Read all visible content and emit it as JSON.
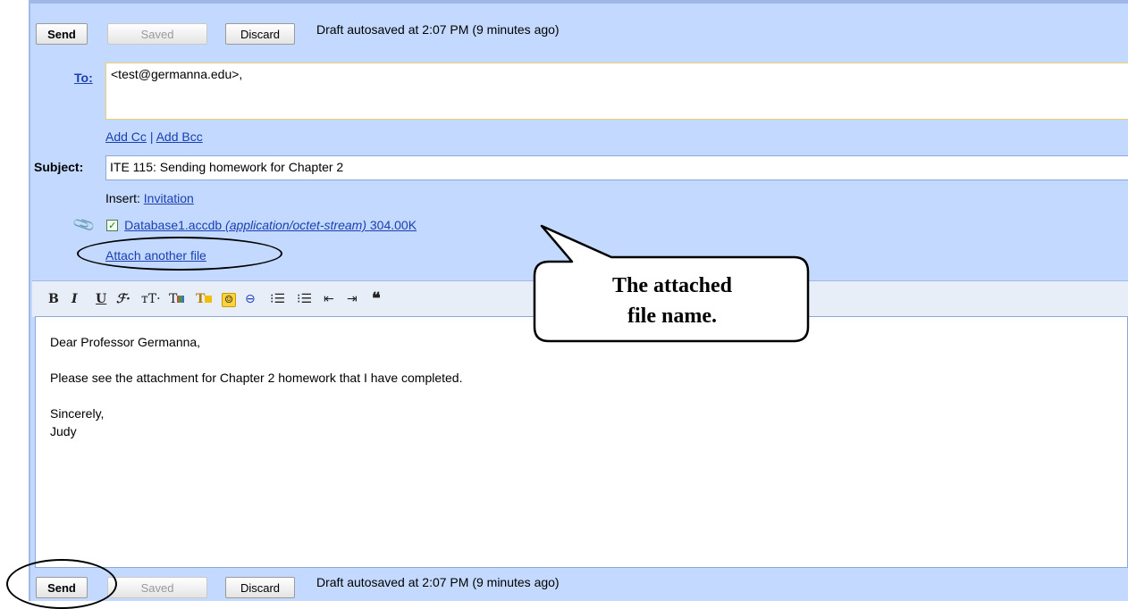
{
  "top_toolbar": {
    "send_label": "Send",
    "saved_label": "Saved",
    "discard_label": "Discard",
    "status_text": "Draft autosaved at 2:07 PM (9 minutes ago)"
  },
  "compose": {
    "to_label": "To:",
    "to_value": "<test@germanna.edu>,",
    "add_cc_label": "Add Cc",
    "separator": "|",
    "add_bcc_label": "Add Bcc",
    "subject_label": "Subject:",
    "subject_value": "ITE 115: Sending homework for Chapter 2",
    "insert_label": "Insert:",
    "insert_invitation_label": "Invitation",
    "attachment": {
      "filename": "Database1.accdb",
      "mime_type": "(application/octet-stream)",
      "size": "304.00K",
      "checked": true
    },
    "attach_another_label": "Attach another file"
  },
  "formatting_toolbar": {
    "icons": [
      "bold-icon",
      "italic-icon",
      "underline-icon",
      "font-icon",
      "text-size-icon",
      "text-color-icon",
      "highlight-color-icon",
      "emoticon-icon",
      "link-icon",
      "numbered-list-icon",
      "bulleted-list-icon",
      "outdent-icon",
      "indent-icon",
      "quote-icon"
    ]
  },
  "body": {
    "greeting": "Dear Professor Germanna,",
    "paragraph": "Please see the attachment for Chapter 2 homework that I have completed.",
    "closing": "Sincerely,",
    "signature": "Judy"
  },
  "bottom_toolbar": {
    "send_label": "Send",
    "saved_label": "Saved",
    "discard_label": "Discard",
    "status_text": "Draft autosaved at 2:07 PM (9 minutes ago)"
  },
  "annotation": {
    "callout_line1": "The attached",
    "callout_line2": "file name."
  },
  "colors": {
    "panel": "#c3d9ff",
    "link": "#1a3fb0",
    "toolbar": "#e8eef8"
  }
}
